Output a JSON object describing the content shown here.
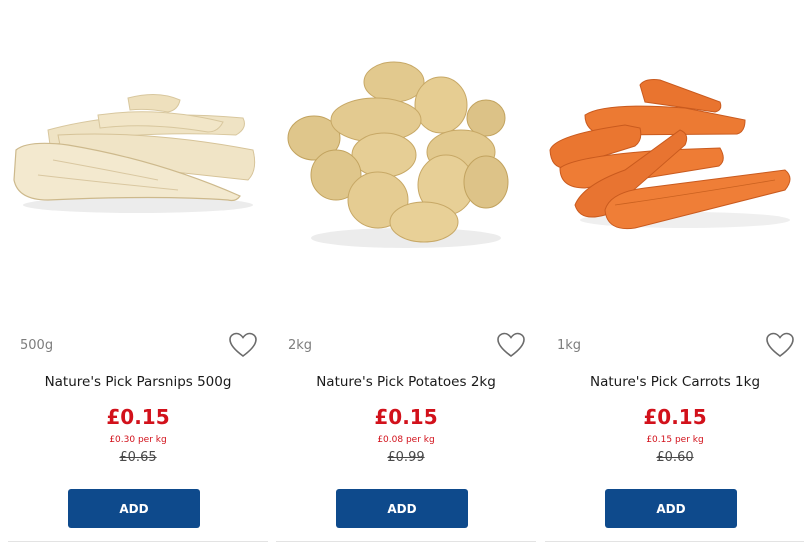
{
  "products": [
    {
      "image_icon": "parsnips-image",
      "weight": "500g",
      "name": "Nature's Pick Parsnips 500g",
      "price": "£0.15",
      "per_kg": "£0.30 per kg",
      "was_price": "£0.65",
      "add_label": "ADD"
    },
    {
      "image_icon": "potatoes-image",
      "weight": "2kg",
      "name": "Nature's Pick Potatoes 2kg",
      "price": "£0.15",
      "per_kg": "£0.08 per kg",
      "was_price": "£0.99",
      "add_label": "ADD"
    },
    {
      "image_icon": "carrots-image",
      "weight": "1kg",
      "name": "Nature's Pick Carrots 1kg",
      "price": "£0.15",
      "per_kg": "£0.15 per kg",
      "was_price": "£0.60",
      "add_label": "ADD"
    }
  ],
  "colors": {
    "price_red": "#d2111b",
    "button_blue": "#0e4a8c",
    "weight_grey": "#7d7d7d"
  }
}
